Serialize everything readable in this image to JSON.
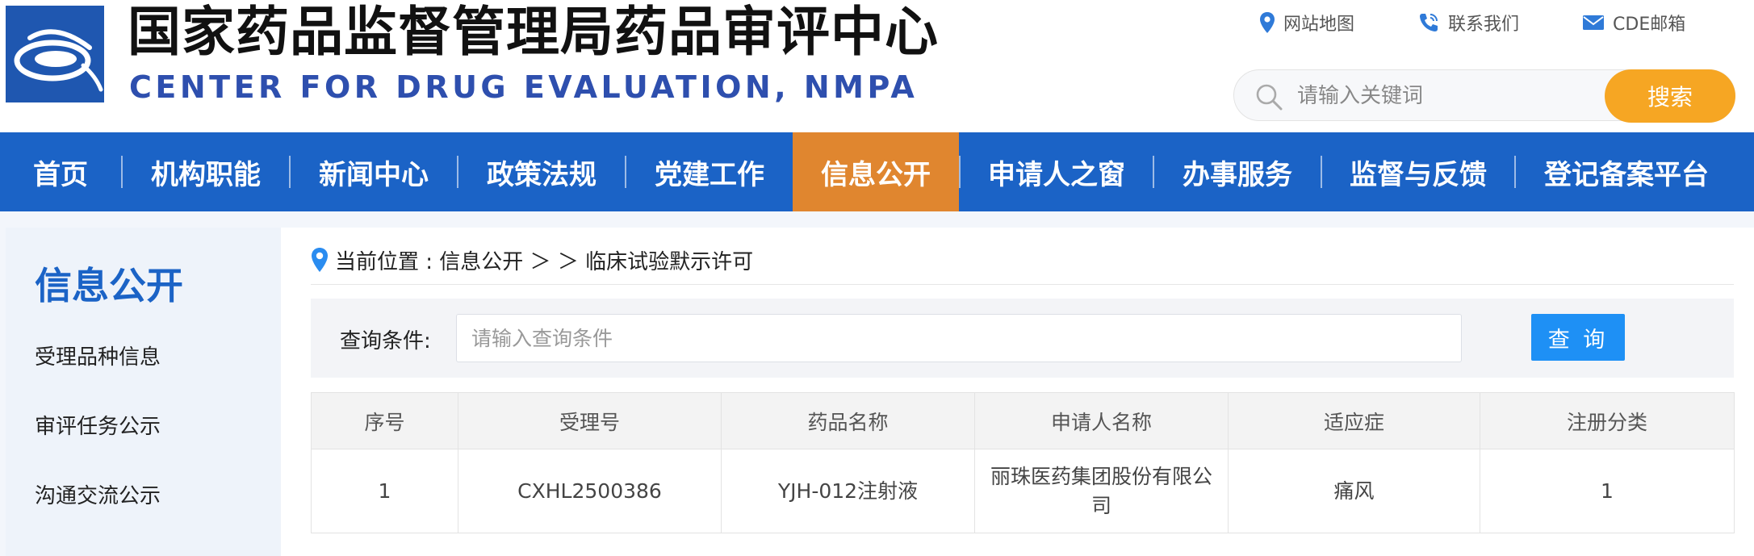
{
  "header": {
    "title": "国家药品监督管理局药品审评中心",
    "subtitle": "CENTER FOR DRUG EVALUATION, NMPA",
    "links": [
      {
        "icon": "location-pin-icon",
        "label": "网站地图"
      },
      {
        "icon": "phone-icon",
        "label": "联系我们"
      },
      {
        "icon": "mail-icon",
        "label": "CDE邮箱"
      }
    ],
    "search": {
      "placeholder": "请输入关键词",
      "button": "搜索"
    }
  },
  "colors": {
    "brand_blue": "#1b63c6",
    "nav_active": "#e0862f",
    "search_button": "#f6a623",
    "query_button": "#1e90f5",
    "subtitle_blue": "#2e4fae"
  },
  "nav": {
    "items": [
      {
        "label": "首页",
        "active": false
      },
      {
        "label": "机构职能",
        "active": false
      },
      {
        "label": "新闻中心",
        "active": false
      },
      {
        "label": "政策法规",
        "active": false
      },
      {
        "label": "党建工作",
        "active": false
      },
      {
        "label": "信息公开",
        "active": true
      },
      {
        "label": "申请人之窗",
        "active": false
      },
      {
        "label": "办事服务",
        "active": false
      },
      {
        "label": "监督与反馈",
        "active": false
      },
      {
        "label": "登记备案平台",
        "active": false
      }
    ]
  },
  "sidebar": {
    "title": "信息公开",
    "items": [
      {
        "label": "受理品种信息"
      },
      {
        "label": "审评任务公示"
      },
      {
        "label": "沟通交流公示"
      }
    ]
  },
  "breadcrumb": {
    "text": "当前位置 : 信息公开 ＞ ＞ 临床试验默示许可"
  },
  "query": {
    "label": "查询条件:",
    "placeholder": "请输入查询条件",
    "button": "查 询"
  },
  "table": {
    "columns": [
      "序号",
      "受理号",
      "药品名称",
      "申请人名称",
      "适应症",
      "注册分类"
    ],
    "rows": [
      [
        "1",
        "CXHL2500386",
        "YJH-012注射液",
        "丽珠医药集团股份有限公司",
        "痛风",
        "1"
      ]
    ]
  }
}
